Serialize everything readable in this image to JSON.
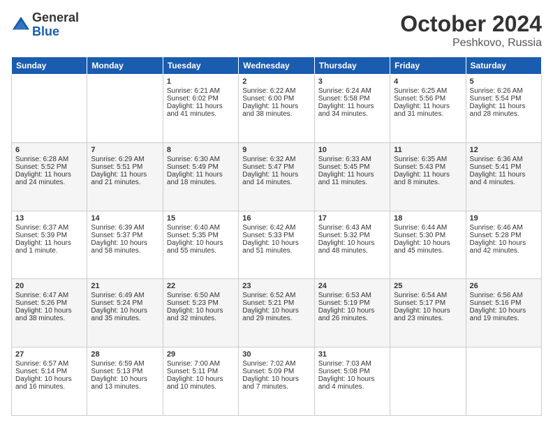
{
  "header": {
    "logo_general": "General",
    "logo_blue": "Blue",
    "month_title": "October 2024",
    "location": "Peshkovo, Russia"
  },
  "weekdays": [
    "Sunday",
    "Monday",
    "Tuesday",
    "Wednesday",
    "Thursday",
    "Friday",
    "Saturday"
  ],
  "weeks": [
    [
      {
        "day": "",
        "sunrise": "",
        "sunset": "",
        "daylight": ""
      },
      {
        "day": "",
        "sunrise": "",
        "sunset": "",
        "daylight": ""
      },
      {
        "day": "1",
        "sunrise": "Sunrise: 6:21 AM",
        "sunset": "Sunset: 6:02 PM",
        "daylight": "Daylight: 11 hours and 41 minutes."
      },
      {
        "day": "2",
        "sunrise": "Sunrise: 6:22 AM",
        "sunset": "Sunset: 6:00 PM",
        "daylight": "Daylight: 11 hours and 38 minutes."
      },
      {
        "day": "3",
        "sunrise": "Sunrise: 6:24 AM",
        "sunset": "Sunset: 5:58 PM",
        "daylight": "Daylight: 11 hours and 34 minutes."
      },
      {
        "day": "4",
        "sunrise": "Sunrise: 6:25 AM",
        "sunset": "Sunset: 5:56 PM",
        "daylight": "Daylight: 11 hours and 31 minutes."
      },
      {
        "day": "5",
        "sunrise": "Sunrise: 6:26 AM",
        "sunset": "Sunset: 5:54 PM",
        "daylight": "Daylight: 11 hours and 28 minutes."
      }
    ],
    [
      {
        "day": "6",
        "sunrise": "Sunrise: 6:28 AM",
        "sunset": "Sunset: 5:52 PM",
        "daylight": "Daylight: 11 hours and 24 minutes."
      },
      {
        "day": "7",
        "sunrise": "Sunrise: 6:29 AM",
        "sunset": "Sunset: 5:51 PM",
        "daylight": "Daylight: 11 hours and 21 minutes."
      },
      {
        "day": "8",
        "sunrise": "Sunrise: 6:30 AM",
        "sunset": "Sunset: 5:49 PM",
        "daylight": "Daylight: 11 hours and 18 minutes."
      },
      {
        "day": "9",
        "sunrise": "Sunrise: 6:32 AM",
        "sunset": "Sunset: 5:47 PM",
        "daylight": "Daylight: 11 hours and 14 minutes."
      },
      {
        "day": "10",
        "sunrise": "Sunrise: 6:33 AM",
        "sunset": "Sunset: 5:45 PM",
        "daylight": "Daylight: 11 hours and 11 minutes."
      },
      {
        "day": "11",
        "sunrise": "Sunrise: 6:35 AM",
        "sunset": "Sunset: 5:43 PM",
        "daylight": "Daylight: 11 hours and 8 minutes."
      },
      {
        "day": "12",
        "sunrise": "Sunrise: 6:36 AM",
        "sunset": "Sunset: 5:41 PM",
        "daylight": "Daylight: 11 hours and 4 minutes."
      }
    ],
    [
      {
        "day": "13",
        "sunrise": "Sunrise: 6:37 AM",
        "sunset": "Sunset: 5:39 PM",
        "daylight": "Daylight: 11 hours and 1 minute."
      },
      {
        "day": "14",
        "sunrise": "Sunrise: 6:39 AM",
        "sunset": "Sunset: 5:37 PM",
        "daylight": "Daylight: 10 hours and 58 minutes."
      },
      {
        "day": "15",
        "sunrise": "Sunrise: 6:40 AM",
        "sunset": "Sunset: 5:35 PM",
        "daylight": "Daylight: 10 hours and 55 minutes."
      },
      {
        "day": "16",
        "sunrise": "Sunrise: 6:42 AM",
        "sunset": "Sunset: 5:33 PM",
        "daylight": "Daylight: 10 hours and 51 minutes."
      },
      {
        "day": "17",
        "sunrise": "Sunrise: 6:43 AM",
        "sunset": "Sunset: 5:32 PM",
        "daylight": "Daylight: 10 hours and 48 minutes."
      },
      {
        "day": "18",
        "sunrise": "Sunrise: 6:44 AM",
        "sunset": "Sunset: 5:30 PM",
        "daylight": "Daylight: 10 hours and 45 minutes."
      },
      {
        "day": "19",
        "sunrise": "Sunrise: 6:46 AM",
        "sunset": "Sunset: 5:28 PM",
        "daylight": "Daylight: 10 hours and 42 minutes."
      }
    ],
    [
      {
        "day": "20",
        "sunrise": "Sunrise: 6:47 AM",
        "sunset": "Sunset: 5:26 PM",
        "daylight": "Daylight: 10 hours and 38 minutes."
      },
      {
        "day": "21",
        "sunrise": "Sunrise: 6:49 AM",
        "sunset": "Sunset: 5:24 PM",
        "daylight": "Daylight: 10 hours and 35 minutes."
      },
      {
        "day": "22",
        "sunrise": "Sunrise: 6:50 AM",
        "sunset": "Sunset: 5:23 PM",
        "daylight": "Daylight: 10 hours and 32 minutes."
      },
      {
        "day": "23",
        "sunrise": "Sunrise: 6:52 AM",
        "sunset": "Sunset: 5:21 PM",
        "daylight": "Daylight: 10 hours and 29 minutes."
      },
      {
        "day": "24",
        "sunrise": "Sunrise: 6:53 AM",
        "sunset": "Sunset: 5:19 PM",
        "daylight": "Daylight: 10 hours and 26 minutes."
      },
      {
        "day": "25",
        "sunrise": "Sunrise: 6:54 AM",
        "sunset": "Sunset: 5:17 PM",
        "daylight": "Daylight: 10 hours and 23 minutes."
      },
      {
        "day": "26",
        "sunrise": "Sunrise: 6:56 AM",
        "sunset": "Sunset: 5:16 PM",
        "daylight": "Daylight: 10 hours and 19 minutes."
      }
    ],
    [
      {
        "day": "27",
        "sunrise": "Sunrise: 6:57 AM",
        "sunset": "Sunset: 5:14 PM",
        "daylight": "Daylight: 10 hours and 16 minutes."
      },
      {
        "day": "28",
        "sunrise": "Sunrise: 6:59 AM",
        "sunset": "Sunset: 5:13 PM",
        "daylight": "Daylight: 10 hours and 13 minutes."
      },
      {
        "day": "29",
        "sunrise": "Sunrise: 7:00 AM",
        "sunset": "Sunset: 5:11 PM",
        "daylight": "Daylight: 10 hours and 10 minutes."
      },
      {
        "day": "30",
        "sunrise": "Sunrise: 7:02 AM",
        "sunset": "Sunset: 5:09 PM",
        "daylight": "Daylight: 10 hours and 7 minutes."
      },
      {
        "day": "31",
        "sunrise": "Sunrise: 7:03 AM",
        "sunset": "Sunset: 5:08 PM",
        "daylight": "Daylight: 10 hours and 4 minutes."
      },
      {
        "day": "",
        "sunrise": "",
        "sunset": "",
        "daylight": ""
      },
      {
        "day": "",
        "sunrise": "",
        "sunset": "",
        "daylight": ""
      }
    ]
  ]
}
